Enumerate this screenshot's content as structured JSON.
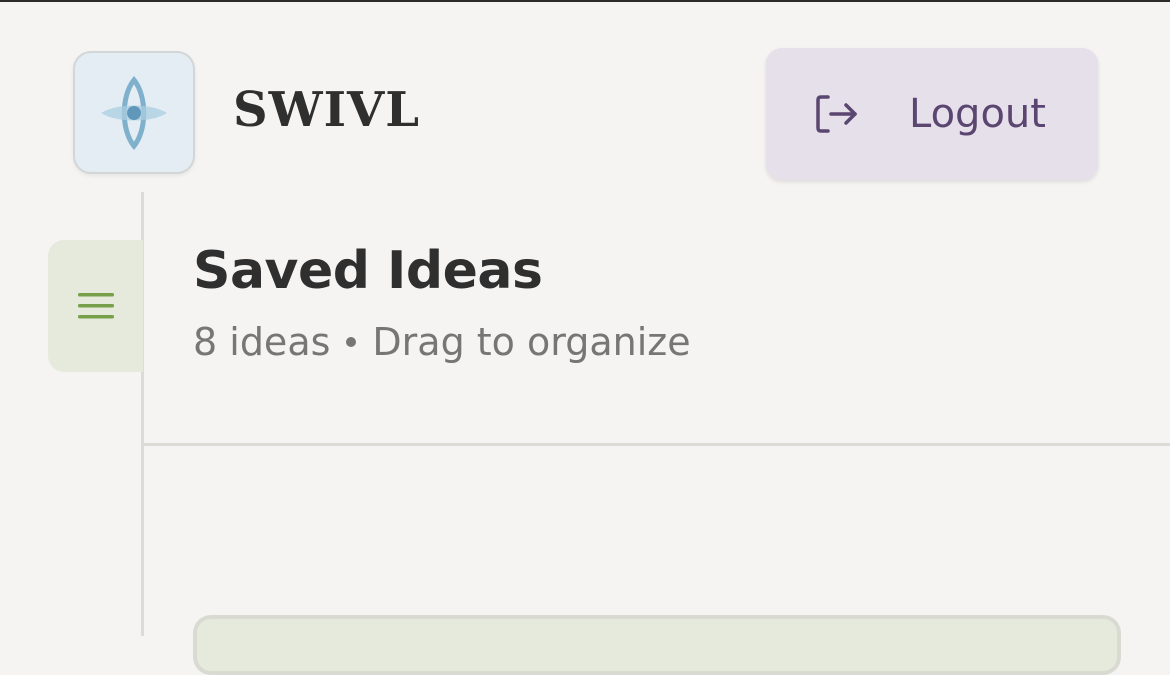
{
  "header": {
    "brand_name": "SWIVL",
    "logo_icon": "eye-compass-icon",
    "logout_label": "Logout",
    "logout_icon": "logout-arrow-icon"
  },
  "sidebar": {
    "menu_icon": "hamburger-menu-icon"
  },
  "main": {
    "title": "Saved Ideas",
    "idea_count": "8 ideas",
    "hint": "Drag to organize"
  },
  "colors": {
    "background": "#f5f4f2",
    "logo_bg": "#e4edf3",
    "logo_accent": "#7fb0cc",
    "logout_bg": "#e6e0ea",
    "logout_text": "#5a4670",
    "menu_bg": "#e6eadc",
    "menu_icon": "#78a04a",
    "title_text": "#2f2f2f",
    "subtitle_text": "#777673"
  }
}
